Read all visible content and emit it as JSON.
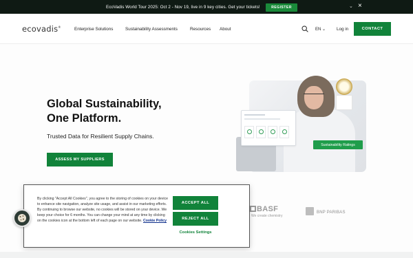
{
  "banner": {
    "text": "EcoVadis World Tour 2025: Oct 2 - Nov 19, live in 9 key cities. Get your tickets!",
    "register_label": "REGISTER",
    "collapse_icon": "chevron-down",
    "close_icon": "close"
  },
  "nav": {
    "logo": "ecovadis",
    "logo_mark": "®",
    "links": [
      "Enterprise Solutions",
      "Sustainability Assessments",
      "Resources",
      "About"
    ],
    "language": "EN",
    "login_label": "Log in",
    "contact_label": "CONTACT"
  },
  "hero": {
    "title_line1": "Global Sustainability,",
    "title_line2": "One Platform.",
    "subtitle": "Trusted Data for Resilient Supply Chains.",
    "cta_label": "ASSESS MY SUPPLIERS",
    "badge_label": "Sustainability Ratings"
  },
  "logos": {
    "basf_name": "BASF",
    "basf_tagline": "We create chemistry",
    "bnp_name": "BNP PARIBAS"
  },
  "cookie": {
    "text": "By clicking \"Accept All Cookies\", you agree to the storing of cookies on your device to enhance site navigation, analyze site usage, and assist in our marketing efforts. By continuing to browse our website, no cookies will be stored on your device. We keep your choice for 6 months. You can change your mind at any time by clicking on the cookies icon at the bottom left of each page on our website.",
    "policy_label": "Cookie Policy",
    "accept_label": "ACCEPT ALL",
    "reject_label": "REJECT ALL",
    "settings_label": "Cookies Settings"
  },
  "colors": {
    "brand_green": "#11833a",
    "banner_bg": "#0f1a14"
  }
}
